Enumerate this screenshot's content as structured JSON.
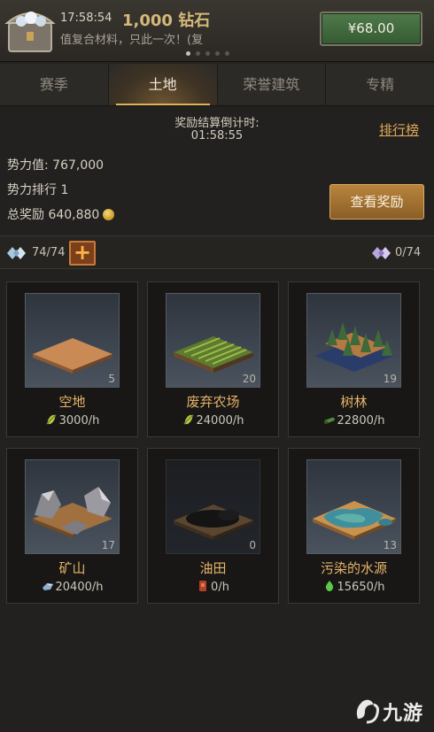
{
  "promo": {
    "time": "17:58:54",
    "amount": "1,000 钻石",
    "description": "值复合材料，只此一次！(复",
    "price": "¥68.00",
    "page_dots": 5,
    "active_dot": 0
  },
  "tabs": [
    {
      "label": "赛季",
      "active": false
    },
    {
      "label": "土地",
      "active": true
    },
    {
      "label": "荣誉建筑",
      "active": false
    },
    {
      "label": "专精",
      "active": false
    }
  ],
  "countdown": {
    "label": "奖励结算倒计时:",
    "value": "01:58:55"
  },
  "rank_link": "排行榜",
  "stats": {
    "power": "势力值: 767,000",
    "rank": "势力排行  1",
    "total_reward": "总奖励  640,880"
  },
  "reward_button": "查看奖励",
  "resources": {
    "left": "74/74",
    "right": "0/74",
    "plus": "+"
  },
  "lands": [
    {
      "name": "空地",
      "count": "5",
      "rate": "3000/h",
      "rate_icon": "corn-icon",
      "dark": false
    },
    {
      "name": "废弃农场",
      "count": "20",
      "rate": "24000/h",
      "rate_icon": "corn-icon",
      "dark": false
    },
    {
      "name": "树林",
      "count": "19",
      "rate": "22800/h",
      "rate_icon": "wood-icon",
      "dark": false
    },
    {
      "name": "矿山",
      "count": "17",
      "rate": "20400/h",
      "rate_icon": "ore-icon",
      "dark": false
    },
    {
      "name": "油田",
      "count": "0",
      "rate": "0/h",
      "rate_icon": "oil-icon",
      "dark": true
    },
    {
      "name": "污染的水源",
      "count": "13",
      "rate": "15650/h",
      "rate_icon": "water-drop-icon",
      "dark": false
    }
  ],
  "watermark": "九游",
  "colors": {
    "accent_gold": "#e6b36a",
    "tab_underline": "#e0b258",
    "price_button": "#4f7a4a",
    "link": "#e0a85a"
  }
}
